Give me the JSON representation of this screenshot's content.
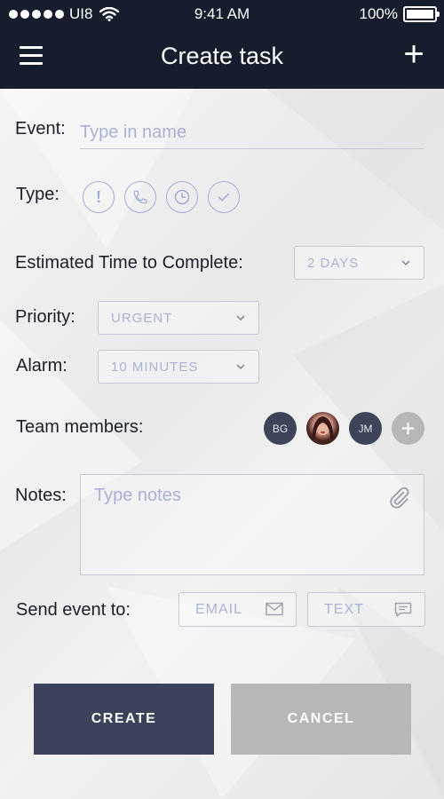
{
  "status_bar": {
    "carrier": "UI8",
    "time": "9:41 AM",
    "battery": "100%",
    "battery_level": 1.0
  },
  "header": {
    "title": "Create task",
    "menu_icon": "hamburger-menu-icon",
    "add_icon": "plus-icon",
    "background": "#161d2c"
  },
  "form": {
    "event": {
      "label": "Event:",
      "placeholder": "Type in name",
      "value": ""
    },
    "type": {
      "label": "Type:",
      "icons": [
        "exclamation-icon",
        "phone-icon",
        "clock-icon",
        "checkmark-icon"
      ]
    },
    "estimated_time": {
      "label": "Estimated Time to Complete:",
      "value": "2 DAYS"
    },
    "priority": {
      "label": "Priority:",
      "value": "URGENT"
    },
    "alarm": {
      "label": "Alarm:",
      "value": "10 MINUTES"
    },
    "team": {
      "label": "Team members:",
      "members": [
        {
          "initials": "BG"
        },
        {
          "initials": "",
          "photo": true
        },
        {
          "initials": "JM"
        }
      ],
      "add_label": "+"
    },
    "notes": {
      "label": "Notes:",
      "placeholder": "Type notes",
      "value": ""
    },
    "send": {
      "label": "Send event to:",
      "email": "EMAIL",
      "text": "TEXT"
    }
  },
  "actions": {
    "create": "CREATE",
    "cancel": "CANCEL"
  },
  "colors": {
    "accent": "#a4aed6",
    "primary_button": "#3c4259",
    "secondary_button": "#b7b7b7",
    "avatar": "#3d4459"
  }
}
